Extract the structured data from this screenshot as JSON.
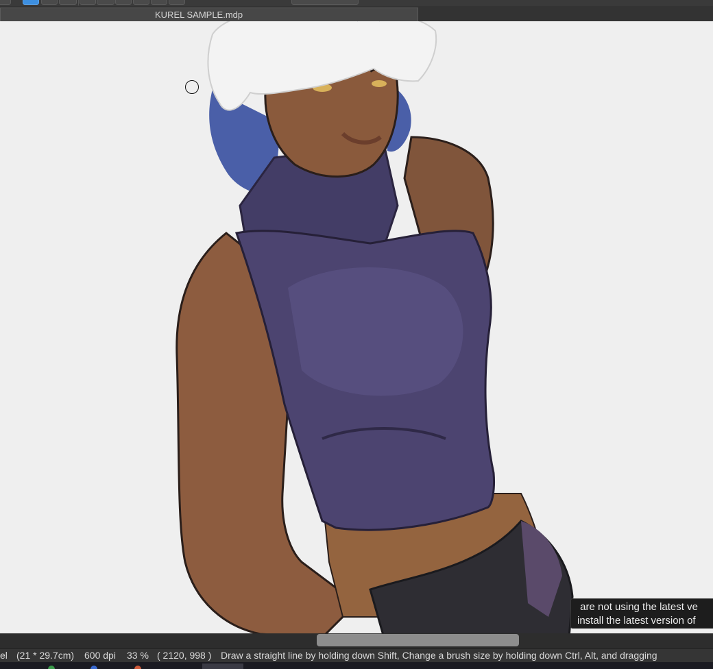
{
  "document": {
    "tab_title": "KUREL SAMPLE.mdp"
  },
  "canvas": {
    "background": "#efefef",
    "illustration": "character-illustration"
  },
  "notification": {
    "line1": " are not using the latest ve",
    "line2": "install the latest version of"
  },
  "status_bar": {
    "unit": "el",
    "paper_size": "(21 * 29.7cm)",
    "resolution": "600 dpi",
    "zoom": "33 %",
    "cursor_position": "( 2120, 998 )",
    "hint": "Draw a straight line by holding down Shift, Change a brush size by holding down Ctrl, Alt, and dragging"
  },
  "colors": {
    "toolbar_bg": "#3a3a3a",
    "active_tool": "#3d8fe0",
    "skin": "#8d5c3f",
    "shirt": "#4c4470",
    "hair": "#f2f2f2",
    "hair_tips": "#4a5fa8",
    "pants": "#2e2d33"
  }
}
